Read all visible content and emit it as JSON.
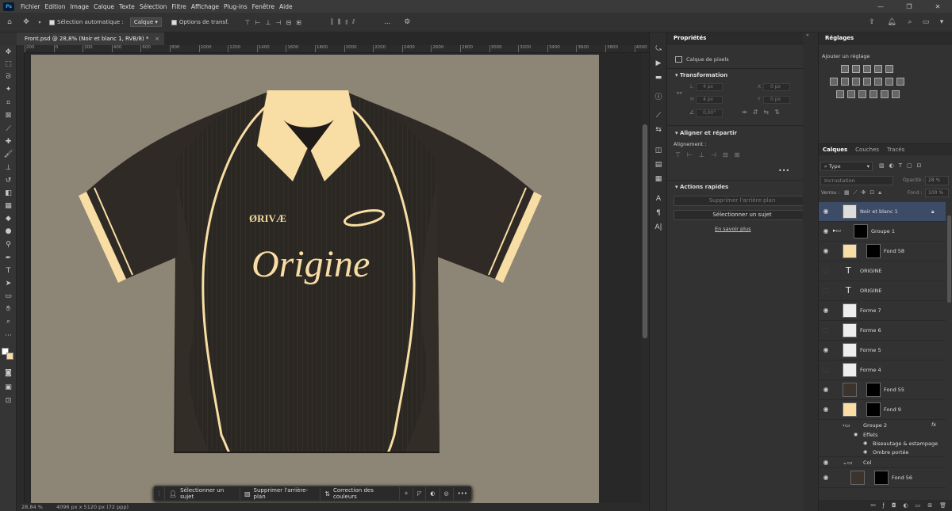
{
  "menu": [
    "Fichier",
    "Edition",
    "Image",
    "Calque",
    "Texte",
    "Sélection",
    "Filtre",
    "Affichage",
    "Plug-ins",
    "Fenêtre",
    "Aide"
  ],
  "options": {
    "auto_select": "Sélection automatique :",
    "layer_select": "Calque",
    "transform": "Options de transf.",
    "more": "..."
  },
  "document": {
    "tab": "Front.psd @ 28,8% (Noir et blanc 1, RVB/8) *",
    "close": "×"
  },
  "ruler_labels": [
    "200",
    "0",
    "200",
    "400",
    "600",
    "800",
    "1000",
    "1200",
    "1400",
    "1600",
    "1800",
    "2000",
    "2200",
    "2400",
    "2600",
    "2800",
    "3000",
    "3200",
    "3400",
    "3600",
    "3800",
    "4000",
    "4200"
  ],
  "status": {
    "zoom": "28,84 %",
    "info": "4096 px x 5120 px (72 ppp)"
  },
  "context_bar": {
    "select_subject": "Sélectionner un sujet",
    "remove_bg": "Supprimer l'arrière-plan",
    "color_correction": "Correction des couleurs",
    "more": "•••"
  },
  "jersey": {
    "brand": "ØRIVÆ",
    "script": "Origine",
    "colors": {
      "body": "#2b2722",
      "accent": "#f8dda4",
      "background": "#8d8576"
    }
  },
  "properties": {
    "title": "Propriétés",
    "layer_type": "Calque de pixels",
    "transform_title": "Transformation",
    "fields": {
      "l": "4 px",
      "h": "4 px",
      "x": "0 px",
      "y": "0 px",
      "angle": "0,00°"
    },
    "field_keys": {
      "l": "L",
      "h": "H",
      "x": "X",
      "y": "Y"
    },
    "align_title": "Aligner et répartir",
    "align_label": "Alignement :",
    "align_more": "•••",
    "quick_title": "Actions rapides",
    "remove_bg": "Supprimer l'arrière-plan",
    "select_subject": "Sélectionner un sujet",
    "learn_more": "En savoir plus"
  },
  "adjustments": {
    "title": "Réglages",
    "add": "Ajouter un réglage"
  },
  "layers_panel": {
    "tabs": [
      "Calques",
      "Couches",
      "Tracés"
    ],
    "filter": "Type",
    "blend": "Incrustation",
    "opacity_label": "Opacité :",
    "opacity": "28 %",
    "lock_label": "Verrou :",
    "fill_label": "Fond :",
    "fill": "100 %",
    "layers": [
      {
        "name": "Noir et blanc 1",
        "visible": true,
        "selected": true
      },
      {
        "name": "Groupe 1",
        "visible": true
      },
      {
        "name": "Fond 58",
        "visible": true
      },
      {
        "name": "ORIGINE",
        "visible": false
      },
      {
        "name": "ORIGINE",
        "visible": false
      },
      {
        "name": "Forme 7",
        "visible": true
      },
      {
        "name": "Forme 6",
        "visible": false
      },
      {
        "name": "Forme 5",
        "visible": true
      },
      {
        "name": "Forme 4",
        "visible": false
      },
      {
        "name": "Fond 55",
        "visible": true
      },
      {
        "name": "Fond 9",
        "visible": true
      },
      {
        "name": "Groupe 2",
        "visible": true
      },
      {
        "name": "Effets",
        "visible": true
      },
      {
        "name": "Biseautage & estampage",
        "visible": true
      },
      {
        "name": "Ombre portée",
        "visible": true
      },
      {
        "name": "Col",
        "visible": true
      },
      {
        "name": "Fond 56",
        "visible": true
      }
    ],
    "fx": "fx"
  }
}
